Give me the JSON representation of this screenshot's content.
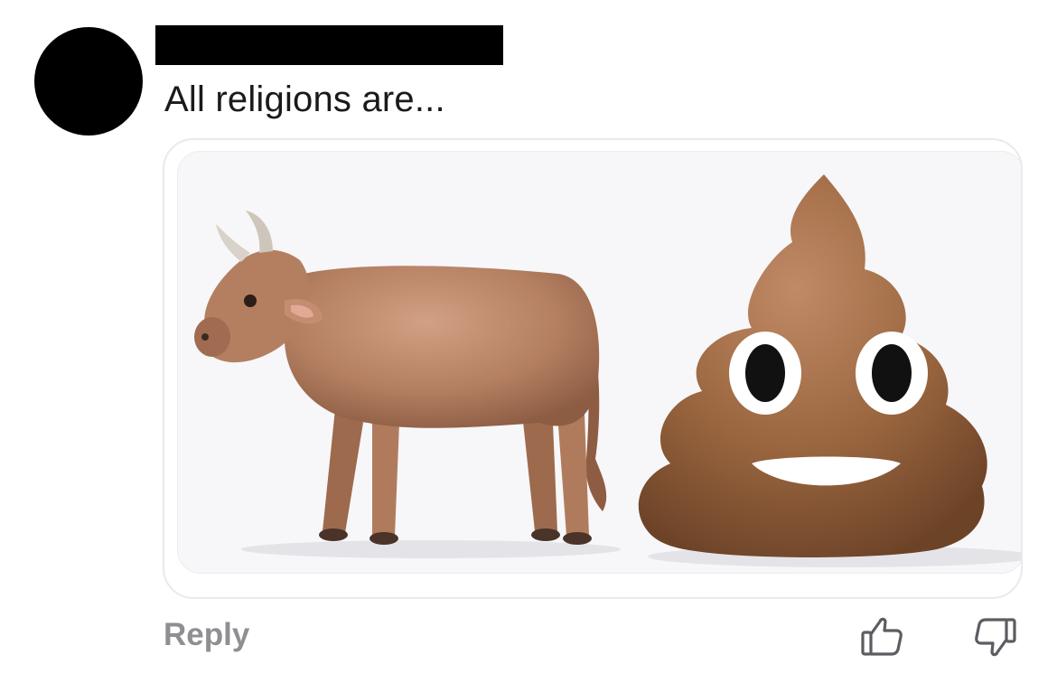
{
  "comment": {
    "author_redacted": true,
    "text": "All religions are...",
    "attachment": {
      "left_emoji": "cow-icon",
      "right_emoji": "poop-icon",
      "caption_fragment": ""
    }
  },
  "actions": {
    "reply_label": "Reply",
    "like_icon": "thumbs-up-icon",
    "dislike_icon": "thumbs-down-icon"
  },
  "colors": {
    "reply_text": "#8e8e93",
    "cow": "#b48063",
    "poop": "#8a5a3c"
  }
}
